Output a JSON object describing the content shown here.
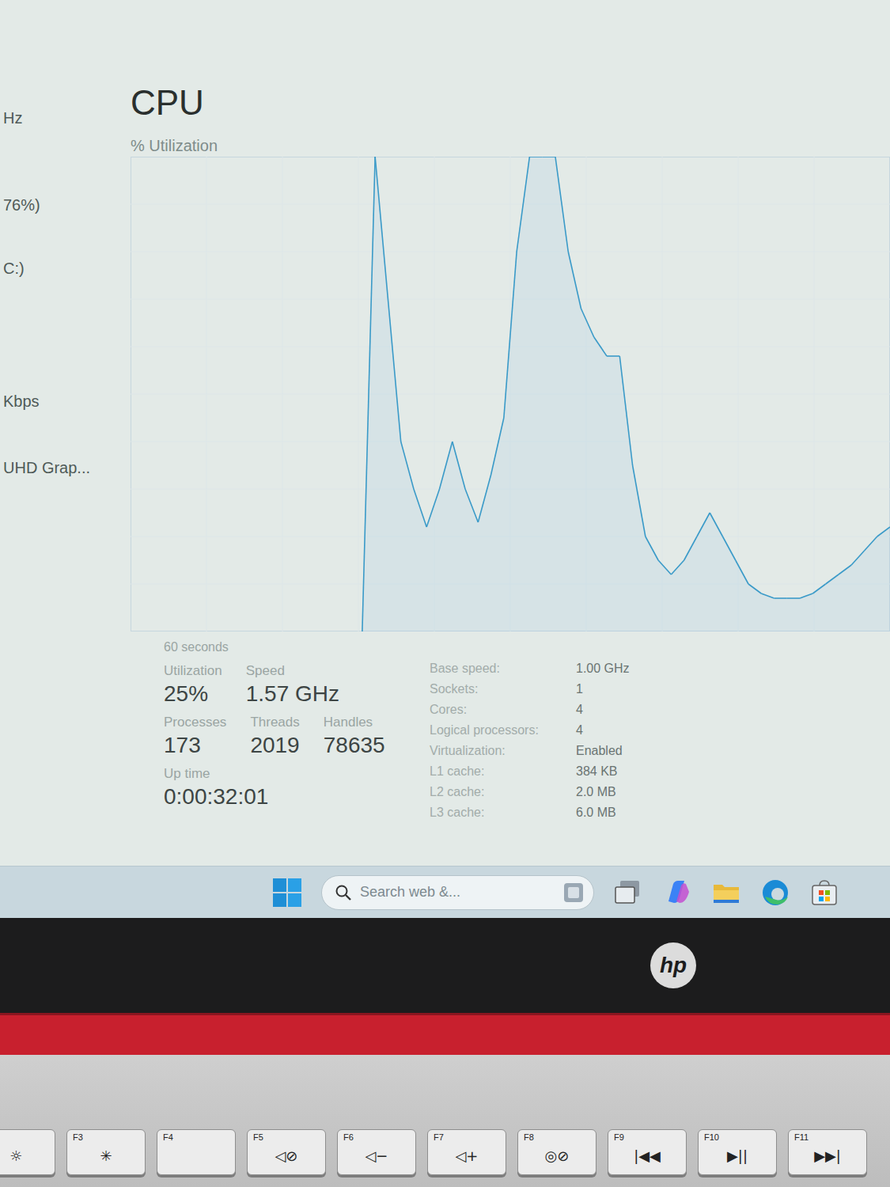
{
  "window": {
    "title": "CPU",
    "subtitle": "% Utilization"
  },
  "sidebar": {
    "items": [
      "Hz",
      "76%)",
      "C:)",
      "Kbps",
      "UHD Grap..."
    ]
  },
  "chart": {
    "x_label": "60 seconds",
    "slots": 60,
    "series": [
      {
        "name": "Utilization",
        "values": [
          0,
          100,
          70,
          40,
          30,
          22,
          30,
          40,
          30,
          23,
          33,
          45,
          80,
          100,
          100,
          100,
          80,
          68,
          62,
          58,
          58,
          35,
          20,
          15,
          12,
          15,
          20,
          25,
          20,
          15,
          10,
          8,
          7,
          7,
          7,
          8,
          10,
          12,
          14,
          17,
          20,
          22
        ]
      }
    ]
  },
  "stat_rows": [
    [
      {
        "label": "Utilization",
        "value": "25%"
      },
      {
        "label": "Speed",
        "value": "1.57 GHz"
      }
    ],
    [
      {
        "label": "Processes",
        "value": "173"
      },
      {
        "label": "Threads",
        "value": "2019"
      },
      {
        "label": "Handles",
        "value": "78635"
      }
    ],
    [
      {
        "label": "Up time",
        "value": "0:00:32:01"
      }
    ]
  ],
  "details": [
    {
      "label": "Base speed:",
      "value": "1.00 GHz"
    },
    {
      "label": "Sockets:",
      "value": "1"
    },
    {
      "label": "Cores:",
      "value": "4"
    },
    {
      "label": "Logical processors:",
      "value": "4"
    },
    {
      "label": "Virtualization:",
      "value": "Enabled"
    },
    {
      "label": "L1 cache:",
      "value": "384 KB"
    },
    {
      "label": "L2 cache:",
      "value": "2.0 MB"
    },
    {
      "label": "L3 cache:",
      "value": "6.0 MB"
    }
  ],
  "taskbar": {
    "search_placeholder": "Search web &..."
  },
  "laptop": {
    "logo": "hp"
  },
  "keys": [
    {
      "fn": "",
      "glyph": "☼"
    },
    {
      "fn": "F3",
      "glyph": "✳"
    },
    {
      "fn": "F4",
      "glyph": ""
    },
    {
      "fn": "F5",
      "glyph": "◁⊘"
    },
    {
      "fn": "F6",
      "glyph": "◁−"
    },
    {
      "fn": "F7",
      "glyph": "◁+"
    },
    {
      "fn": "F8",
      "glyph": "◎⊘"
    },
    {
      "fn": "F9",
      "glyph": "|◀◀"
    },
    {
      "fn": "F10",
      "glyph": "▶||"
    },
    {
      "fn": "F11",
      "glyph": "▶▶|"
    }
  ]
}
